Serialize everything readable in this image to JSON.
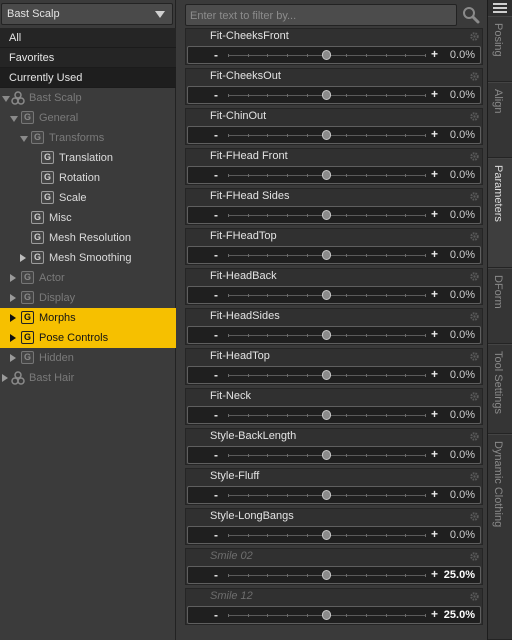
{
  "scope": {
    "label": "Bast Scalp"
  },
  "filters": [
    "All",
    "Favorites",
    "Currently Used"
  ],
  "tree": [
    {
      "label": "Bast Scalp",
      "kind": "figure",
      "depth": 0,
      "twisty": "open",
      "state": "dim"
    },
    {
      "label": "General",
      "kind": "group",
      "depth": 1,
      "twisty": "open",
      "state": "dim"
    },
    {
      "label": "Transforms",
      "kind": "group",
      "depth": 2,
      "twisty": "open",
      "state": "dim"
    },
    {
      "label": "Translation",
      "kind": "group",
      "depth": 3,
      "twisty": "none",
      "state": "norm"
    },
    {
      "label": "Rotation",
      "kind": "group",
      "depth": 3,
      "twisty": "none",
      "state": "norm"
    },
    {
      "label": "Scale",
      "kind": "group",
      "depth": 3,
      "twisty": "none",
      "state": "norm"
    },
    {
      "label": "Misc",
      "kind": "group",
      "depth": 2,
      "twisty": "none",
      "state": "norm"
    },
    {
      "label": "Mesh Resolution",
      "kind": "group",
      "depth": 2,
      "twisty": "none",
      "state": "norm"
    },
    {
      "label": "Mesh Smoothing",
      "kind": "group",
      "depth": 2,
      "twisty": "closed",
      "state": "norm"
    },
    {
      "label": "Actor",
      "kind": "group",
      "depth": 1,
      "twisty": "closed",
      "state": "dim"
    },
    {
      "label": "Display",
      "kind": "group",
      "depth": 1,
      "twisty": "closed",
      "state": "dim"
    },
    {
      "label": "Morphs",
      "kind": "group",
      "depth": 1,
      "twisty": "closed",
      "state": "hl"
    },
    {
      "label": "Pose Controls",
      "kind": "group",
      "depth": 1,
      "twisty": "closed",
      "state": "hl"
    },
    {
      "label": "Hidden",
      "kind": "group",
      "depth": 1,
      "twisty": "closed",
      "state": "dim"
    },
    {
      "label": "Bast Hair",
      "kind": "figure",
      "depth": 0,
      "twisty": "closed",
      "state": "dim"
    }
  ],
  "search": {
    "placeholder": "Enter text to filter by..."
  },
  "params": [
    {
      "name": "Fit-CheeksFront",
      "value": "0.0%",
      "pos": 0.5,
      "disabled": false
    },
    {
      "name": "Fit-CheeksOut",
      "value": "0.0%",
      "pos": 0.5,
      "disabled": false
    },
    {
      "name": "Fit-ChinOut",
      "value": "0.0%",
      "pos": 0.5,
      "disabled": false
    },
    {
      "name": "Fit-FHead Front",
      "value": "0.0%",
      "pos": 0.5,
      "disabled": false
    },
    {
      "name": "Fit-FHead Sides",
      "value": "0.0%",
      "pos": 0.5,
      "disabled": false
    },
    {
      "name": "Fit-FHeadTop",
      "value": "0.0%",
      "pos": 0.5,
      "disabled": false
    },
    {
      "name": "Fit-HeadBack",
      "value": "0.0%",
      "pos": 0.5,
      "disabled": false
    },
    {
      "name": "Fit-HeadSides",
      "value": "0.0%",
      "pos": 0.5,
      "disabled": false
    },
    {
      "name": "Fit-HeadTop",
      "value": "0.0%",
      "pos": 0.5,
      "disabled": false
    },
    {
      "name": "Fit-Neck",
      "value": "0.0%",
      "pos": 0.5,
      "disabled": false
    },
    {
      "name": "Style-BackLength",
      "value": "0.0%",
      "pos": 0.5,
      "disabled": false
    },
    {
      "name": "Style-Fluff",
      "value": "0.0%",
      "pos": 0.5,
      "disabled": false
    },
    {
      "name": "Style-LongBangs",
      "value": "0.0%",
      "pos": 0.5,
      "disabled": false
    },
    {
      "name": "Smile 02",
      "value": "25.0%",
      "pos": 0.5,
      "disabled": true
    },
    {
      "name": "Smile 12",
      "value": "25.0%",
      "pos": 0.5,
      "disabled": true
    }
  ],
  "tabs": [
    "Posing",
    "Align",
    "Parameters",
    "DForm",
    "Tool Settings",
    "Dynamic Clothing"
  ],
  "active_tab": "Parameters",
  "colors": {
    "highlight": "#f6c000",
    "panel": "#3a3a3a",
    "field": "#1f1f1f"
  }
}
